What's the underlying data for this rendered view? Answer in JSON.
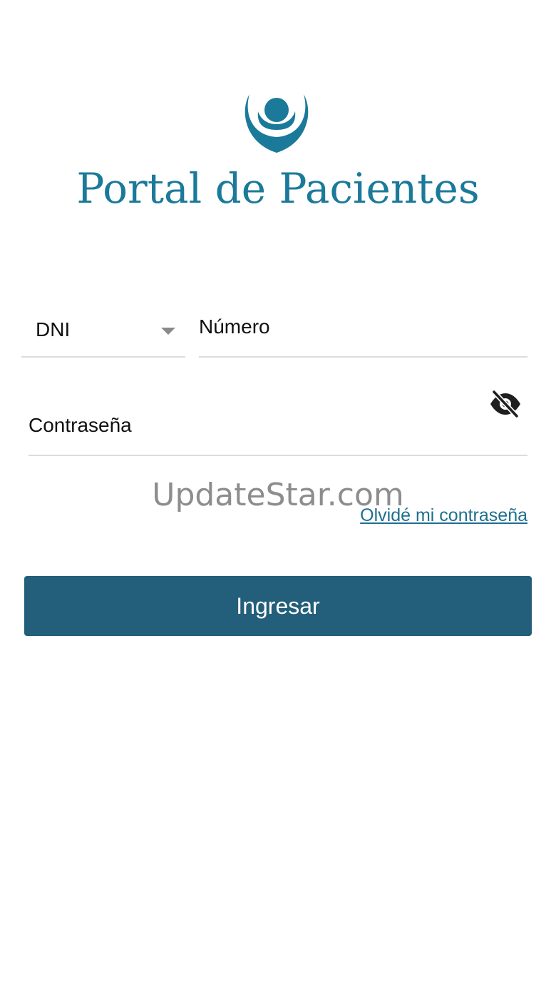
{
  "brand": {
    "logo_icon": "patient-portal-logo",
    "title": "Portal de Pacientes",
    "color": "#1b7a9a"
  },
  "login_form": {
    "doc_type": {
      "selected": "DNI",
      "icon": "chevron-down-icon"
    },
    "doc_number": {
      "placeholder": "Número"
    },
    "password": {
      "placeholder": "Contraseña",
      "visibility_icon": "eye-off-icon"
    },
    "forgot_password_link": "Olvidé mi contraseña",
    "submit_label": "Ingresar",
    "submit_color": "#235e7a"
  },
  "watermark": "UpdateStar.com"
}
